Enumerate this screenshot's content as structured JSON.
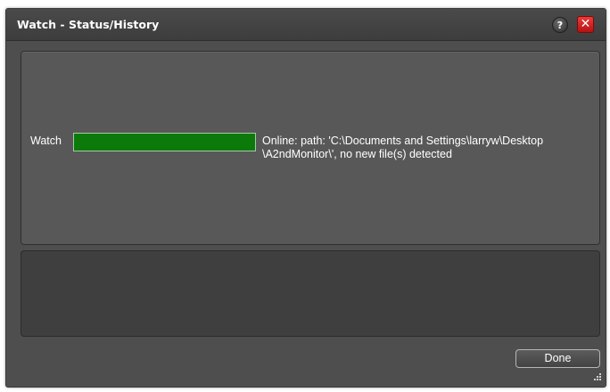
{
  "window": {
    "title": "Watch - Status/History",
    "help_label": "?",
    "close_label": "✕"
  },
  "watch": {
    "label": "Watch",
    "status_text": "Online: path: 'C:\\Documents and Settings\\larryw\\Desktop\n\\A2ndMonitor\\', no new file(s) detected",
    "status_color": "#0b7a0b"
  },
  "history": {
    "entries": []
  },
  "footer": {
    "done_label": "Done"
  },
  "icons": {
    "help": "question-mark-icon",
    "close": "close-icon",
    "resize": "resize-grip-icon"
  },
  "colors": {
    "background": "#4e4e4e",
    "panel": "#585858",
    "history_panel": "#3f3f3f",
    "close_red": "#d62020"
  }
}
